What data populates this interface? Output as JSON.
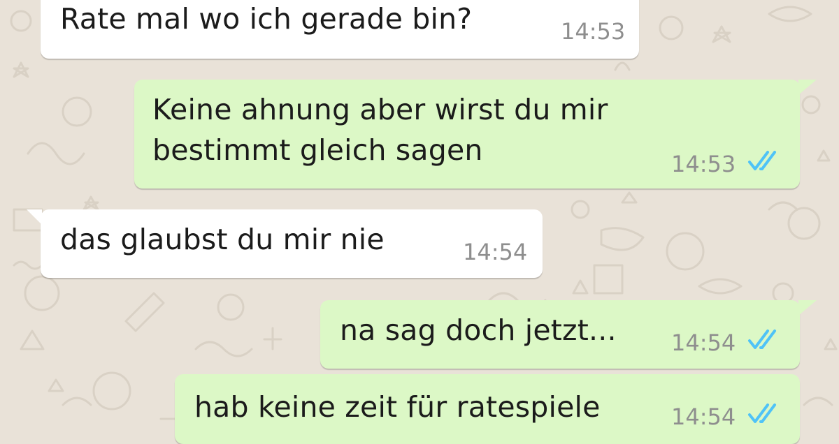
{
  "colors": {
    "wallpaper": "#e9e2d8",
    "incoming_bubble": "#ffffff",
    "outgoing_bubble": "#dcf8c6",
    "timestamp": "#8e8e8e",
    "read_ticks": "#4fc3f7"
  },
  "messages": [
    {
      "direction": "incoming",
      "text": "Rate mal wo ich gerade bin?",
      "time": "14:53"
    },
    {
      "direction": "outgoing",
      "text": "Keine ahnung aber wirst du mir\nbestimmt gleich sagen",
      "time": "14:53",
      "status_icon": "double-check-read-icon"
    },
    {
      "direction": "incoming",
      "text": "das glaubst du mir nie",
      "time": "14:54"
    },
    {
      "direction": "outgoing",
      "text": "na sag doch jetzt...",
      "time": "14:54",
      "status_icon": "double-check-read-icon"
    },
    {
      "direction": "outgoing",
      "text": "hab keine zeit für ratespiele",
      "time": "14:54",
      "status_icon": "double-check-read-icon"
    }
  ]
}
